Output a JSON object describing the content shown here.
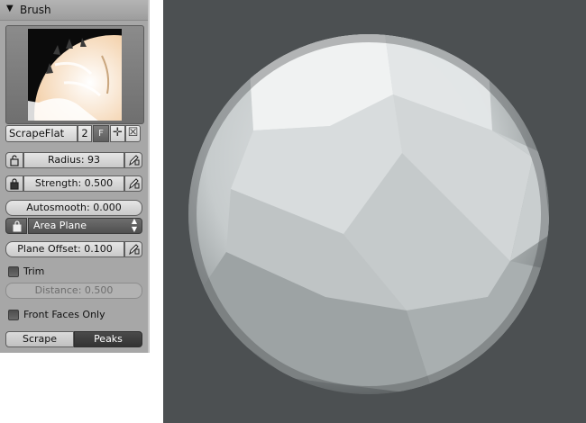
{
  "panel": {
    "title": "Brush",
    "collapse_icon": "triangle-down-icon"
  },
  "brush": {
    "name": "ScrapeFlat",
    "users": "2",
    "fake_user": "F",
    "add_icon": "plus-icon",
    "remove_icon": "x-icon"
  },
  "radius": {
    "label": "Radius: 93"
  },
  "strength": {
    "label": "Strength: 0.500"
  },
  "autosmooth": {
    "label": "Autosmooth: 0.000"
  },
  "area": {
    "label": "Area Plane"
  },
  "plane_offset": {
    "label": "Plane Offset: 0.100"
  },
  "trim": {
    "label": "Trim",
    "checked": false
  },
  "distance": {
    "label": "Distance: 0.500"
  },
  "front_faces": {
    "label": "Front Faces Only",
    "checked": false
  },
  "direction": {
    "options": [
      "Scrape",
      "Peaks"
    ],
    "selected": "Peaks"
  },
  "colors": {
    "panel_bg": "#a7a7a7",
    "viewport_bg": "#4c5052",
    "active_button": "#3a3a3a",
    "mesh": "#d9dcdc"
  }
}
